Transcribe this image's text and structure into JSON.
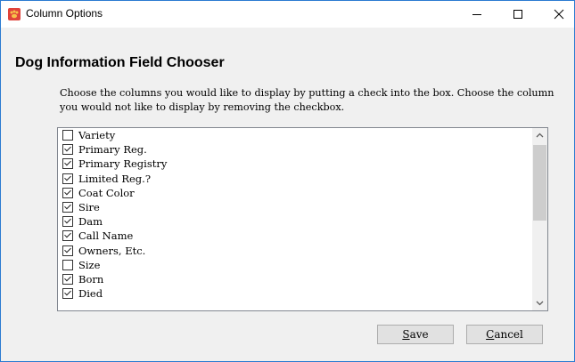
{
  "window": {
    "title": "Column Options",
    "icon": "app-paw-icon",
    "controls": {
      "minimize": "—",
      "maximize": "☐",
      "close": "✕"
    }
  },
  "heading": "Dog Information Field Chooser",
  "instructions": {
    "line1": "Choose the columns you would like to display by putting a check into the box.  Choose the column",
    "line2": "you would not like to display by removing the checkbox."
  },
  "fields": [
    {
      "label": "Variety",
      "checked": false
    },
    {
      "label": "Primary Reg.",
      "checked": true
    },
    {
      "label": "Primary Registry",
      "checked": true
    },
    {
      "label": "Limited Reg.?",
      "checked": true
    },
    {
      "label": "Coat Color",
      "checked": true
    },
    {
      "label": "Sire",
      "checked": true
    },
    {
      "label": "Dam",
      "checked": true
    },
    {
      "label": "Call Name",
      "checked": true
    },
    {
      "label": "Owners, Etc.",
      "checked": true
    },
    {
      "label": "Size",
      "checked": false
    },
    {
      "label": "Born",
      "checked": true
    },
    {
      "label": "Died",
      "checked": true
    }
  ],
  "buttons": {
    "save": {
      "mnemonic": "S",
      "rest": "ave"
    },
    "cancel": {
      "mnemonic": "C",
      "rest": "ancel"
    }
  },
  "colors": {
    "accent_border": "#2b7bd1",
    "icon_red": "#e0433a"
  }
}
